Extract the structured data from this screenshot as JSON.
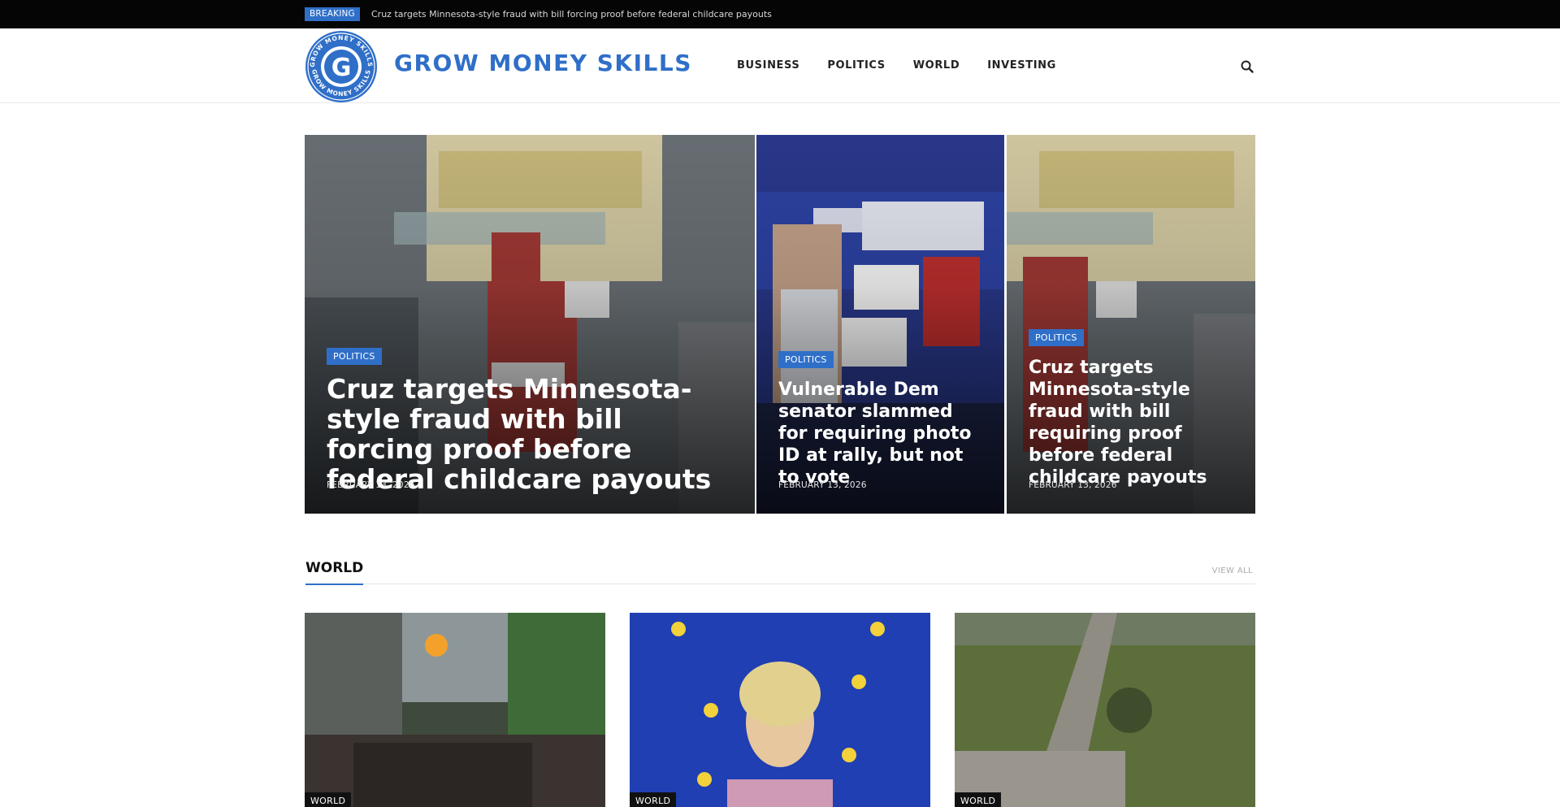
{
  "breaking": {
    "badge": "BREAKING",
    "headline": "Cruz targets Minnesota-style fraud with bill forcing proof before federal childcare payouts"
  },
  "header": {
    "logo_text": "GROW MONEY SKILLS",
    "logo_ring_text": "GROW MONEY SKILLS",
    "logo_letter": "G",
    "nav": [
      "BUSINESS",
      "POLITICS",
      "WORLD",
      "INVESTING"
    ],
    "search_icon": "search-icon"
  },
  "hero": [
    {
      "category": "POLITICS",
      "title": "Cruz targets Minnesota-style fraud with bill forcing proof before federal childcare payouts",
      "date": "FEBRUARY 13, 2026",
      "image": "sign-removal-photo"
    },
    {
      "category": "POLITICS",
      "title": "Vulnerable Dem senator slammed for requiring photo ID at rally, but not to vote",
      "date": "FEBRUARY 13, 2026",
      "image": "rally-photo"
    },
    {
      "category": "POLITICS",
      "title": "Cruz targets Minnesota-style fraud with bill requiring proof before federal childcare payouts",
      "date": "FEBRUARY 13, 2026",
      "image": "sign-removal-photo"
    }
  ],
  "world": {
    "title": "WORLD",
    "view_all": "VIEW ALL",
    "cards": [
      {
        "category": "WORLD",
        "image": "protest-photo"
      },
      {
        "category": "WORLD",
        "image": "eu-speaker-photo"
      },
      {
        "category": "WORLD",
        "image": "fallen-tree-wall-photo"
      }
    ]
  },
  "colors": {
    "accent": "#2f6fc8",
    "topbar": "#050505"
  }
}
